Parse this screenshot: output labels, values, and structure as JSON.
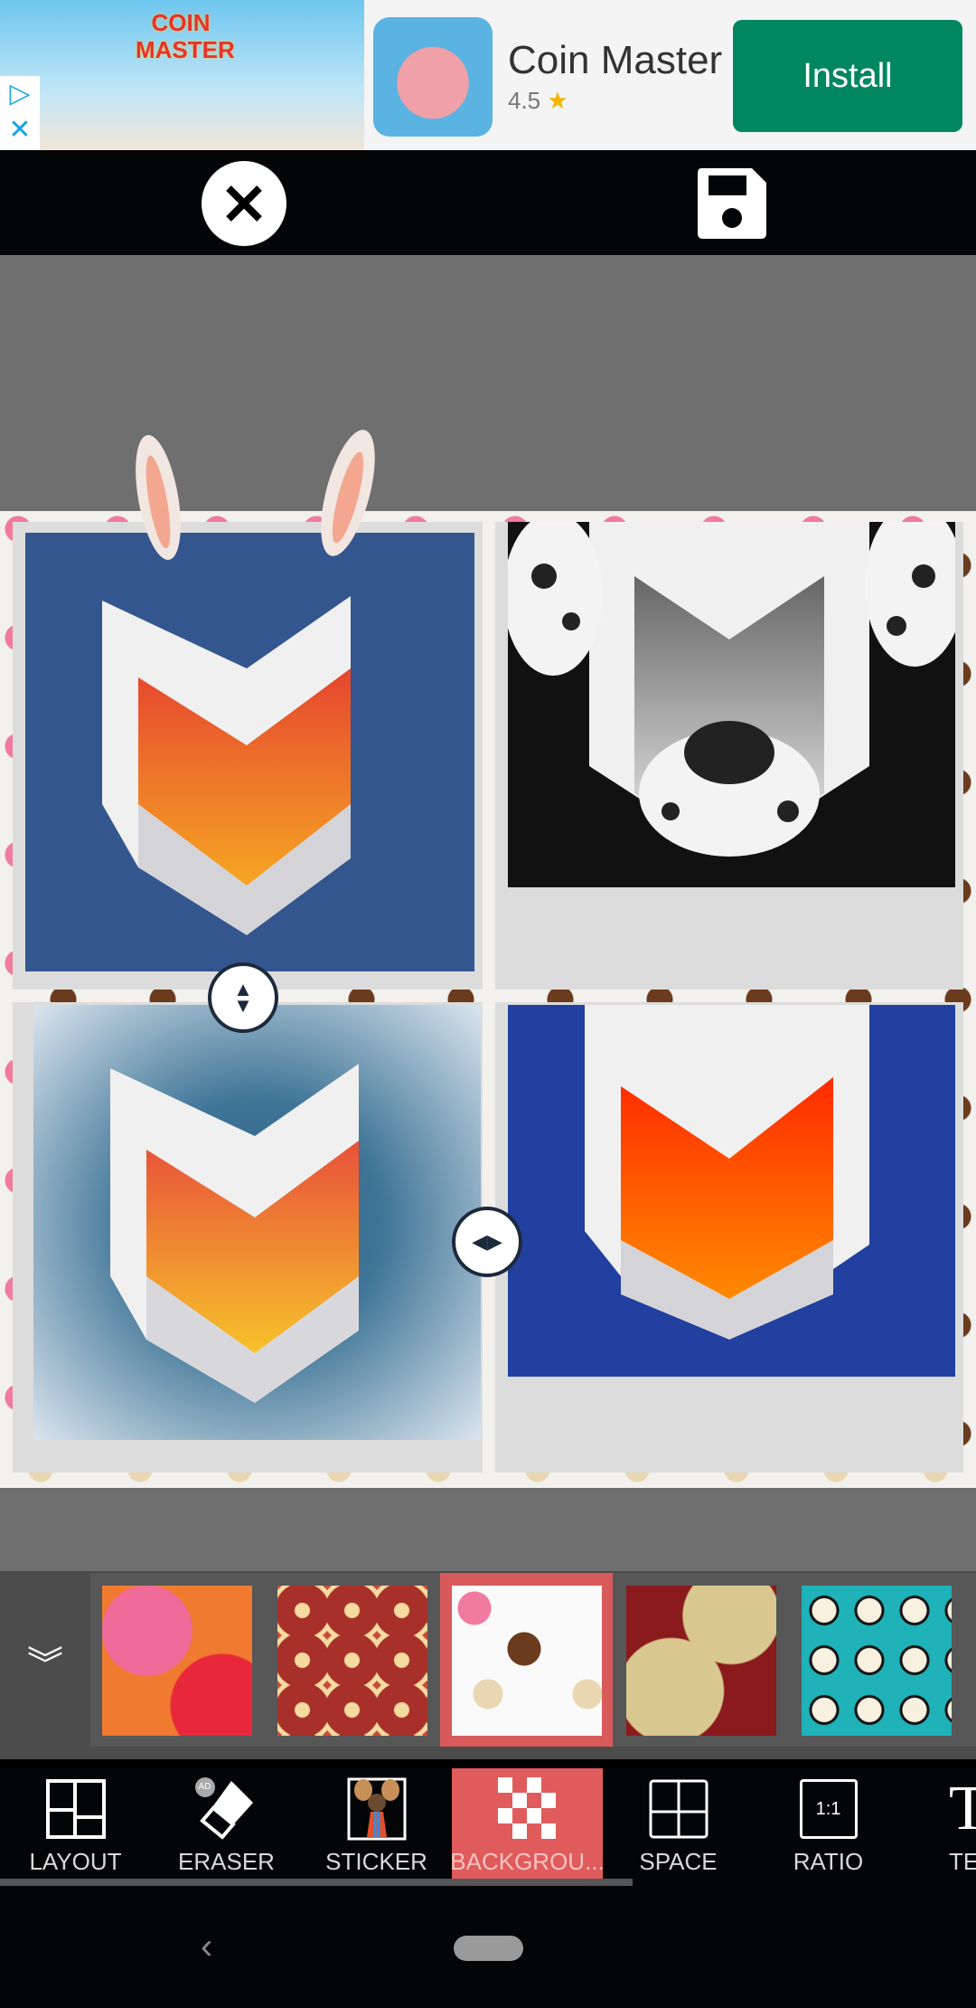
{
  "ad": {
    "banner_logo": "COIN MASTER",
    "app_name": "Coin Master",
    "rating": "4.5",
    "star": "★",
    "install_label": "Install",
    "adchoices_icon": "adchoices-icon",
    "close_icon": "close-icon"
  },
  "top_bar": {
    "close_icon": "close-circle-icon",
    "save_icon": "floppy-save-icon"
  },
  "collage": {
    "background_pattern": "donuts",
    "cells": [
      {
        "content": "orange shield logo with bunny ears on blue",
        "bg": "#34568f"
      },
      {
        "content": "gray shield logo with dalmatian face on black",
        "bg": "#111111"
      },
      {
        "content": "orange-yellow shield logo on blue vignette",
        "bg": "#3f7597"
      },
      {
        "content": "red-orange shield logo on deep blue",
        "bg": "#2140a0"
      }
    ],
    "vertical_handle_icon": "resize-vertical-icon",
    "horizontal_handle_icon": "resize-horizontal-icon"
  },
  "background_strip": {
    "collapse_icon": "chevron-double-down-icon",
    "selected_index": 2,
    "thumbnails": [
      {
        "name": "grapefruit"
      },
      {
        "name": "arrows"
      },
      {
        "name": "donuts"
      },
      {
        "name": "red-net"
      },
      {
        "name": "pandas"
      }
    ]
  },
  "toolbar": {
    "items": [
      {
        "label": "LAYOUT",
        "icon": "layout-grid-icon"
      },
      {
        "label": "ERASER",
        "icon": "eraser-icon",
        "badge": "AD"
      },
      {
        "label": "STICKER",
        "icon": "sticker-icon"
      },
      {
        "label": "BACKGROU...",
        "icon": "checkerboard-icon",
        "selected": true
      },
      {
        "label": "SPACE",
        "icon": "space-grid-icon"
      },
      {
        "label": "RATIO",
        "icon": "ratio-icon",
        "icon_text": "1:1"
      },
      {
        "label": "TE",
        "icon": "text-icon",
        "icon_text": "T"
      }
    ]
  },
  "colors": {
    "accent": "#e05b5b",
    "install": "#01875f"
  }
}
